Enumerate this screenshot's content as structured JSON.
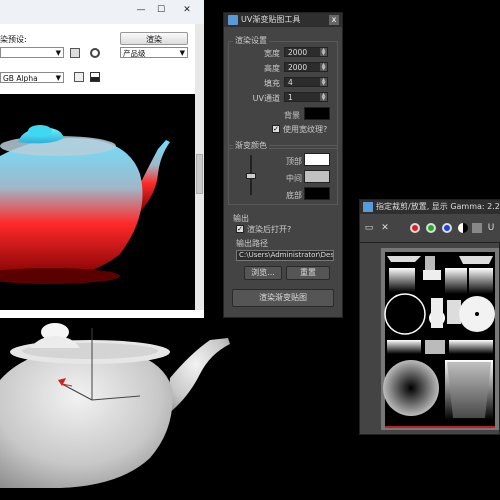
{
  "render_window": {
    "title_buttons": {
      "minimize": "—",
      "maximize": "☐",
      "close": "✕"
    },
    "preset_label": "染预设:",
    "preset_value": "",
    "render_button": "渲染",
    "quality_value": "产品级",
    "channel_value": "GB Alpha"
  },
  "uv_panel": {
    "title": "UV渐变贴图工具",
    "close": "x",
    "render_settings": {
      "group_title": "渲染设置",
      "width_label": "宽度",
      "width_value": "2000",
      "height_label": "高度",
      "height_value": "2000",
      "padding_label": "填充",
      "padding_value": "4",
      "uv_channel_label": "UV通道",
      "uv_channel_value": "1",
      "background_label": "背景",
      "use_texture_label": "使用宽纹理?",
      "use_texture_checked": true
    },
    "gradient_colors": {
      "group_title": "渐变颜色",
      "top_label": "顶部",
      "top_color": "#ffffff",
      "middle_label": "中间",
      "middle_color": "#c0c0c0",
      "bottom_label": "底部",
      "bottom_color": "#000000",
      "background_color": "#000000"
    },
    "output": {
      "group_title": "输出",
      "open_after_render_label": "渲染后打开?",
      "open_after_render_checked": true,
      "path_label": "输出路径",
      "path_value": "C:\\Users\\Administrator\\Des",
      "browse_button": "浏览...",
      "reset_button": "重置"
    },
    "render_gradient_button": "渲染渐变贴图"
  },
  "uv_viewer": {
    "title": "指定裁剪/放置, 显示 Gamma: 2.2",
    "channel_colors": {
      "red": "#e02020",
      "green": "#20b020",
      "blue": "#2040e0"
    },
    "toolbar_u": "U"
  }
}
